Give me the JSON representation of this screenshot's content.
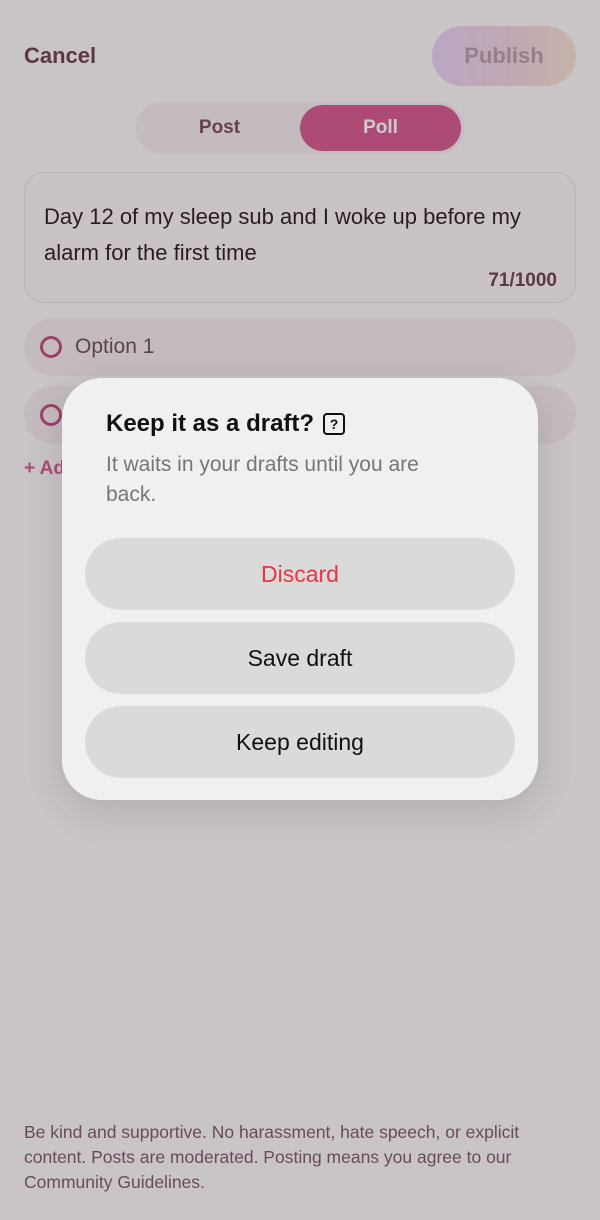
{
  "header": {
    "cancel_label": "Cancel",
    "publish_label": "Publish"
  },
  "tabs": [
    {
      "label": "Post",
      "active": false
    },
    {
      "label": "Poll",
      "active": true
    }
  ],
  "composer": {
    "text": "Day 12 of my sleep sub and I woke up before my alarm for the first time",
    "char_count": "71/1000"
  },
  "poll": {
    "options": [
      {
        "label": "Option 1"
      },
      {
        "label": ""
      }
    ],
    "add_option_label": "+ Add option"
  },
  "footer": {
    "guidelines": "Be kind and supportive. No harassment, hate speech, or explicit content. Posts are moderated. Posting means you agree to our Community Guidelines."
  },
  "dialog": {
    "title": "Keep it as a draft?",
    "help_icon": "?",
    "subtitle": "It waits in your drafts until you are back.",
    "discard_label": "Discard",
    "save_label": "Save draft",
    "keep_label": "Keep editing"
  },
  "colors": {
    "accent": "#d6568e",
    "destructive": "#f0343c"
  }
}
